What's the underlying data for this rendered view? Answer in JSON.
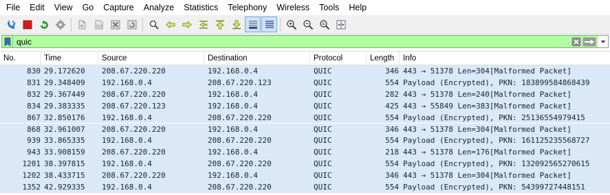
{
  "menu": [
    "File",
    "Edit",
    "View",
    "Go",
    "Capture",
    "Analyze",
    "Statistics",
    "Telephony",
    "Wireless",
    "Tools",
    "Help"
  ],
  "toolbar": {
    "buttons": [
      {
        "name": "start-capture-icon"
      },
      {
        "name": "stop-capture-icon"
      },
      {
        "name": "restart-capture-icon"
      },
      {
        "name": "capture-options-icon"
      },
      {
        "name": "open-file-icon"
      },
      {
        "name": "save-file-icon"
      },
      {
        "name": "close-file-icon"
      },
      {
        "name": "reload-file-icon"
      },
      {
        "name": "find-packet-icon"
      },
      {
        "name": "go-back-icon"
      },
      {
        "name": "go-forward-icon"
      },
      {
        "name": "go-to-packet-icon"
      },
      {
        "name": "go-first-icon"
      },
      {
        "name": "go-last-icon"
      },
      {
        "name": "auto-scroll-icon"
      },
      {
        "name": "colorize-icon"
      },
      {
        "name": "zoom-in-icon"
      },
      {
        "name": "zoom-out-icon"
      },
      {
        "name": "zoom-normal-icon"
      },
      {
        "name": "resize-columns-icon"
      }
    ]
  },
  "filter": {
    "value": "quic",
    "background_color": "#b0ffa0"
  },
  "columns": [
    "No.",
    "Time",
    "Source",
    "Destination",
    "Protocol",
    "Length",
    "Info"
  ],
  "rows": [
    {
      "no": "830",
      "time": "29.172620",
      "source": "208.67.220.220",
      "destination": "192.168.0.4",
      "protocol": "QUIC",
      "length": "346",
      "info": "443 → 51378 Len=304[Malformed Packet]"
    },
    {
      "no": "831",
      "time": "29.348409",
      "source": "192.168.0.4",
      "destination": "208.67.220.123",
      "protocol": "QUIC",
      "length": "554",
      "info": "Payload (Encrypted), PKN: 183899584868439"
    },
    {
      "no": "832",
      "time": "29.367449",
      "source": "208.67.220.220",
      "destination": "192.168.0.4",
      "protocol": "QUIC",
      "length": "282",
      "info": "443 → 51378 Len=240[Malformed Packet]"
    },
    {
      "no": "834",
      "time": "29.383335",
      "source": "208.67.220.123",
      "destination": "192.168.0.4",
      "protocol": "QUIC",
      "length": "425",
      "info": "443 → 55849 Len=383[Malformed Packet]"
    },
    {
      "no": "867",
      "time": "32.850176",
      "source": "192.168.0.4",
      "destination": "208.67.220.220",
      "protocol": "QUIC",
      "length": "554",
      "info": "Payload (Encrypted), PKN: 25136554979415"
    },
    {
      "no": "868",
      "time": "32.961007",
      "source": "208.67.220.220",
      "destination": "192.168.0.4",
      "protocol": "QUIC",
      "length": "346",
      "info": "443 → 51378 Len=304[Malformed Packet]"
    },
    {
      "no": "939",
      "time": "33.865335",
      "source": "192.168.0.4",
      "destination": "208.67.220.220",
      "protocol": "QUIC",
      "length": "554",
      "info": "Payload (Encrypted), PKN: 161125235568727"
    },
    {
      "no": "943",
      "time": "33.908159",
      "source": "208.67.220.220",
      "destination": "192.168.0.4",
      "protocol": "QUIC",
      "length": "218",
      "info": "443 → 51378 Len=176[Malformed Packet]"
    },
    {
      "no": "1201",
      "time": "38.397815",
      "source": "192.168.0.4",
      "destination": "208.67.220.220",
      "protocol": "QUIC",
      "length": "554",
      "info": "Payload (Encrypted), PKN: 132092565270615"
    },
    {
      "no": "1202",
      "time": "38.433715",
      "source": "208.67.220.220",
      "destination": "192.168.0.4",
      "protocol": "QUIC",
      "length": "346",
      "info": "443 → 51378 Len=304[Malformed Packet]"
    },
    {
      "no": "1352",
      "time": "42.929335",
      "source": "192.168.0.4",
      "destination": "208.67.220.220",
      "protocol": "QUIC",
      "length": "554",
      "info": "Payload (Encrypted), PKN: 54399727448151"
    }
  ],
  "colors": {
    "row_background": "#dae8f8",
    "row_text": "#12272e"
  }
}
